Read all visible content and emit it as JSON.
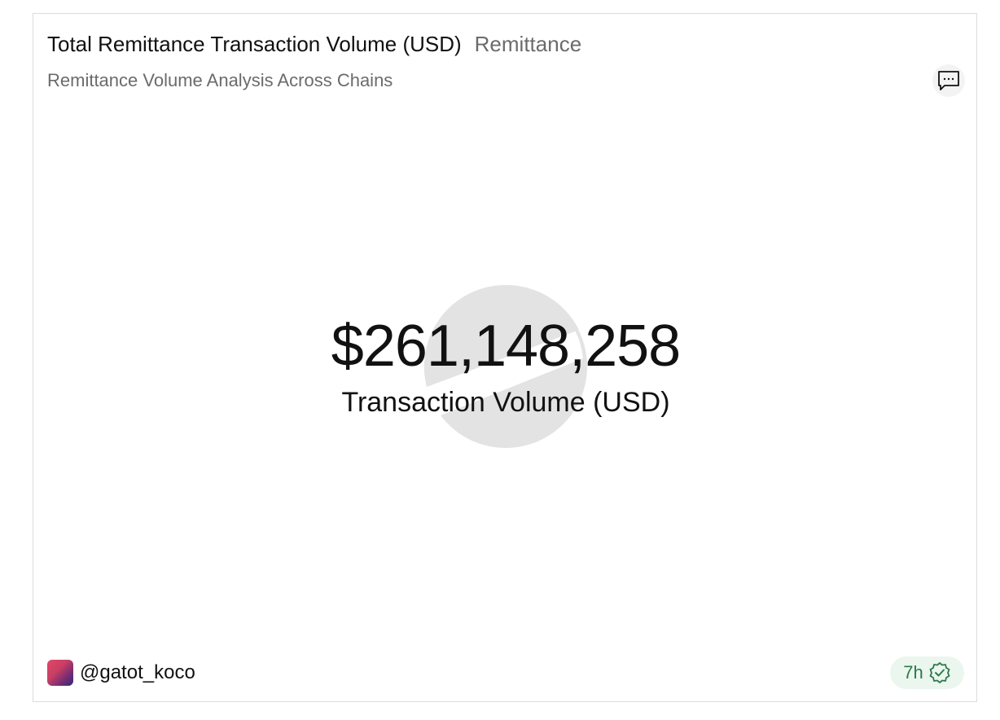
{
  "card": {
    "title": "Total Remittance Transaction Volume (USD)",
    "tag": "Remittance",
    "subtitle": "Remittance Volume Analysis Across Chains",
    "comment_icon": "comment-icon"
  },
  "metric": {
    "value": "$261,148,258",
    "label": "Transaction Volume (USD)"
  },
  "footer": {
    "username": "@gatot_koco",
    "age": "7h",
    "verified_icon": "verified-check-icon"
  },
  "colors": {
    "accent_green": "#2e7a4a",
    "badge_bg": "#ebf6ee",
    "muted_text": "#6b6b6b"
  }
}
